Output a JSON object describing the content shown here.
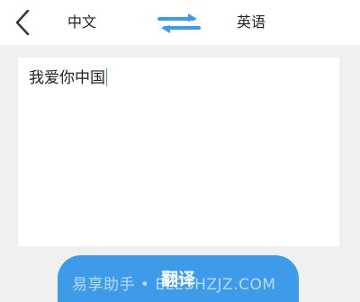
{
  "header": {
    "back_icon": "chevron-left-icon",
    "source_language": "中文",
    "target_language": "英语",
    "swap_icon": "swap-arrows-icon",
    "accent": "#3e9be9"
  },
  "input": {
    "text": "我爱你中国"
  },
  "action": {
    "translate_label": "翻译",
    "color": "#3e9be9"
  },
  "watermark": {
    "text": "易享助手 • ELESHZJZ.COM"
  }
}
